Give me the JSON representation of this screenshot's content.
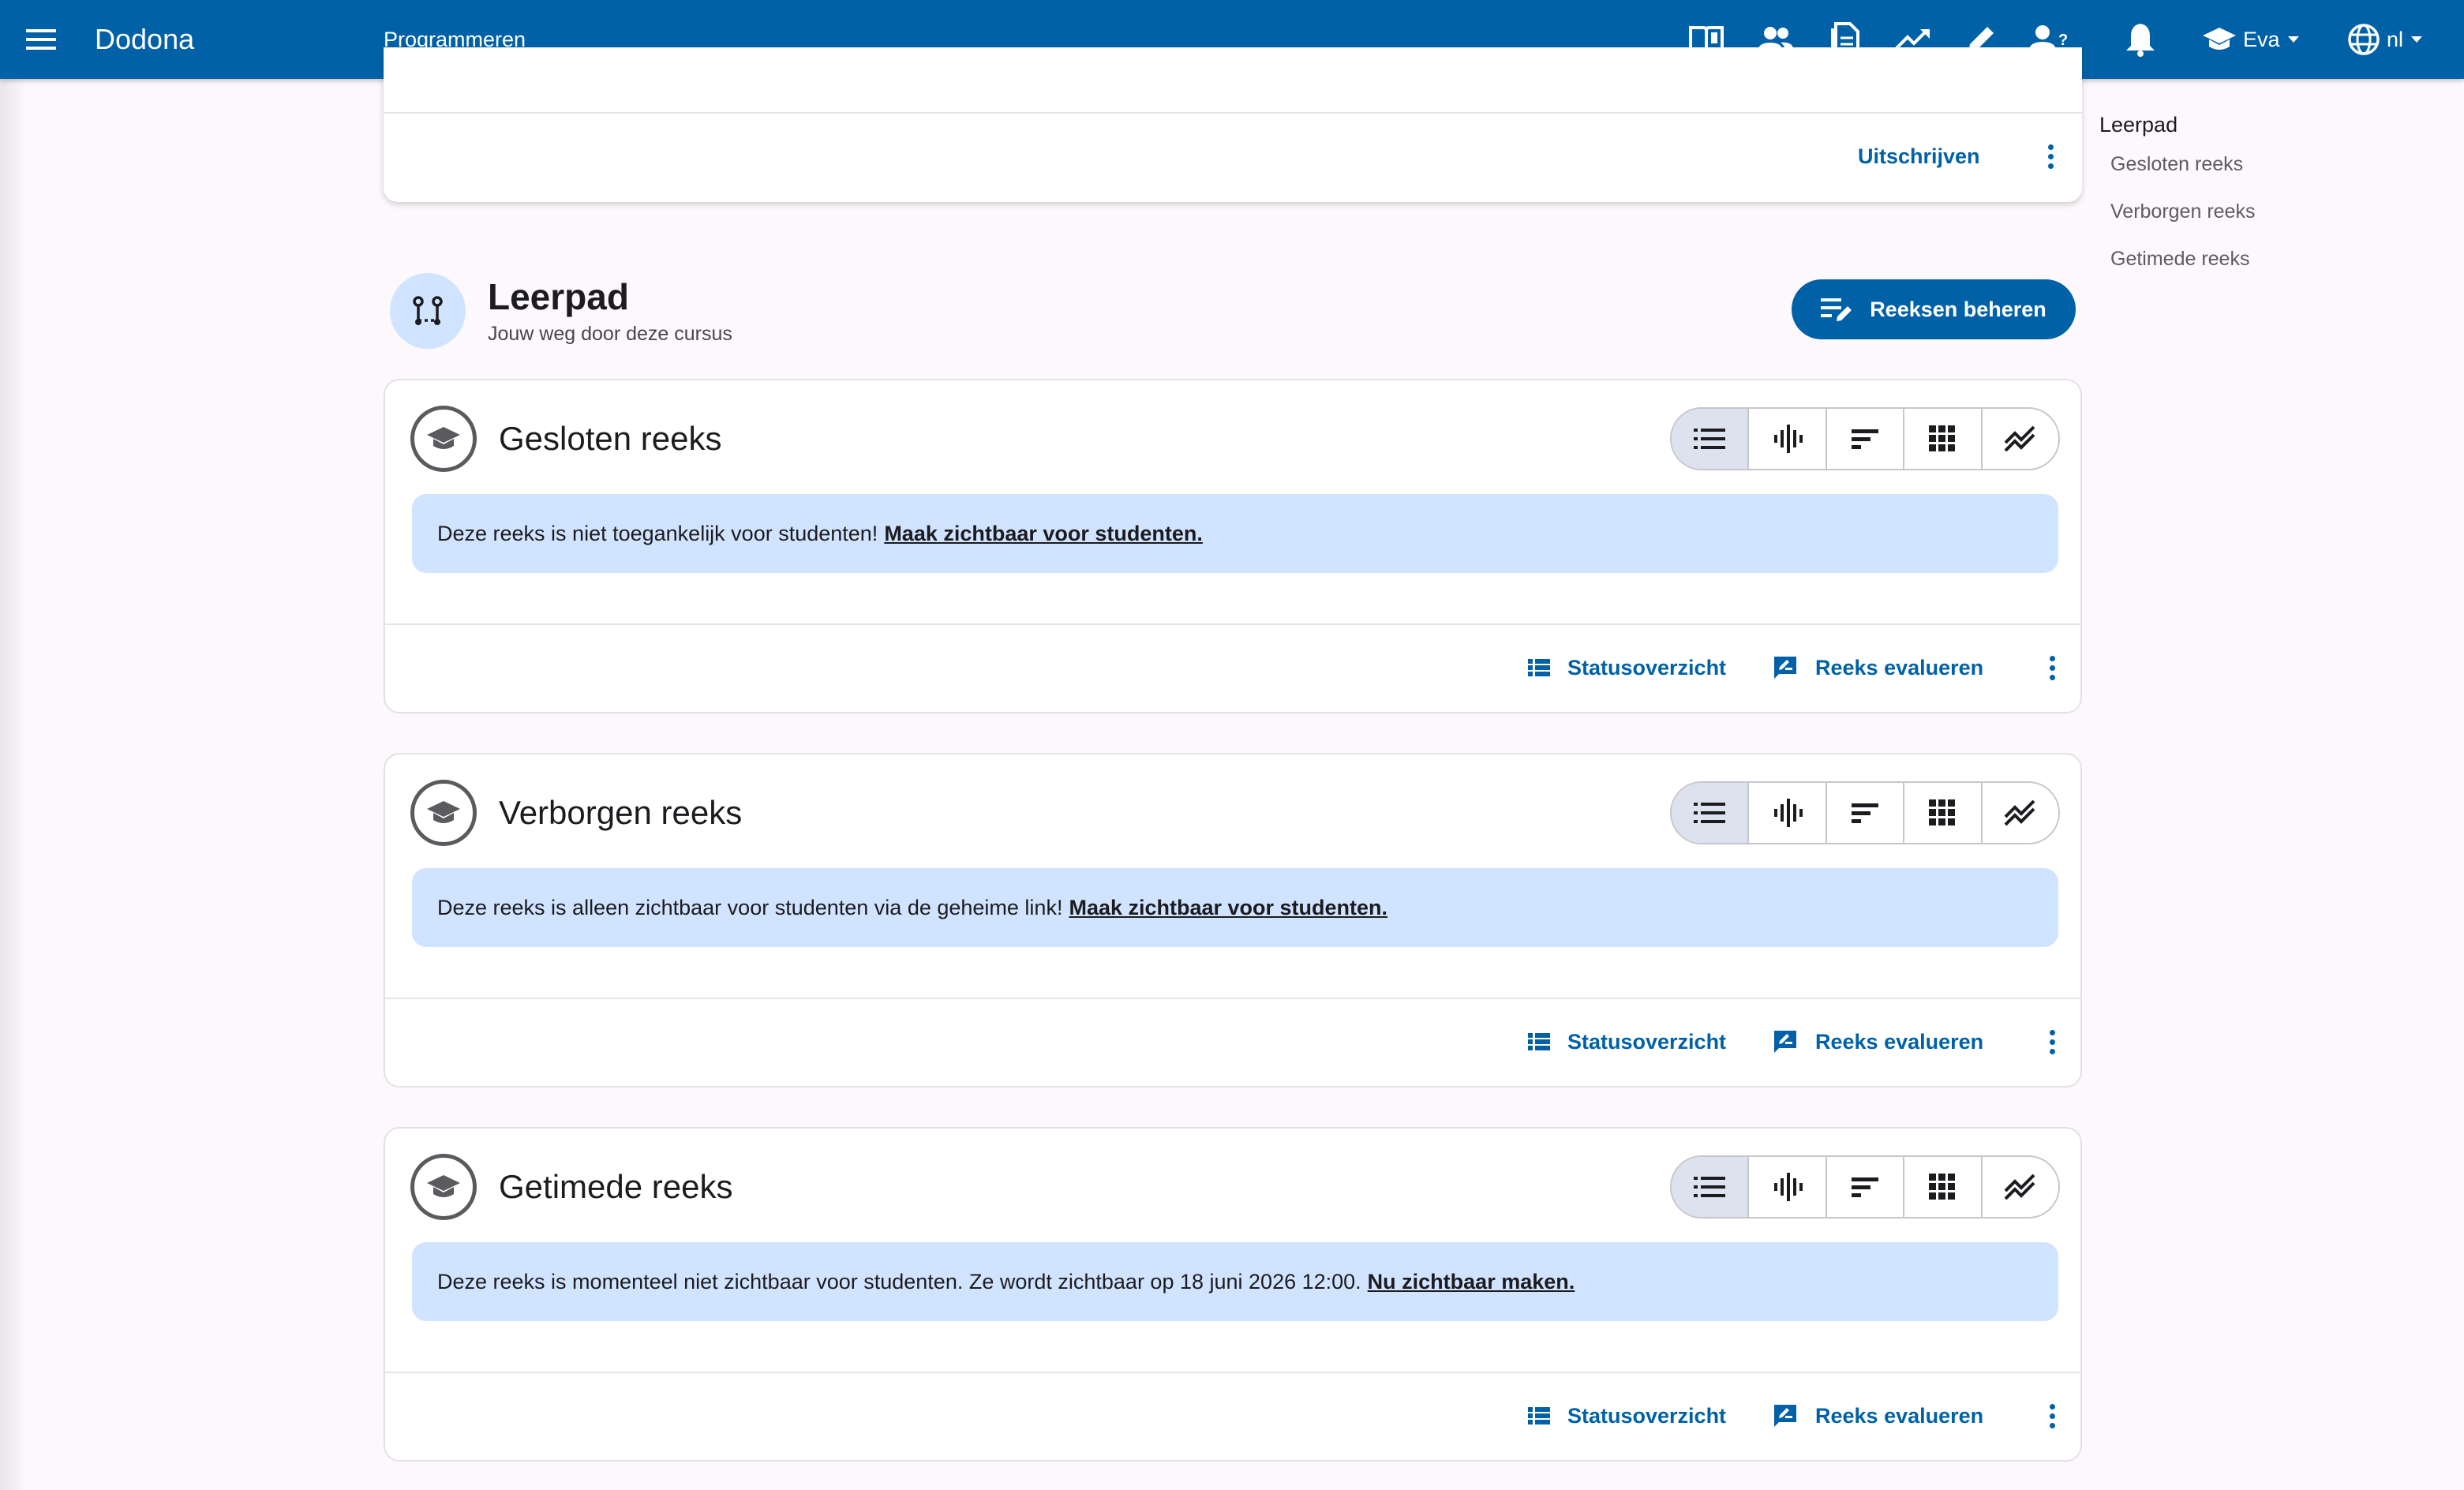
{
  "appbar": {
    "brand": "Dodona",
    "course": "Programmeren",
    "user_name": "Eva",
    "language": "nl",
    "nav_icons": [
      "course-book-icon",
      "users-icon",
      "document-icon",
      "trending-up-icon",
      "pencil-icon",
      "user-question-icon",
      "bell-icon"
    ]
  },
  "top_card": {
    "unsubscribe_label": "Uitschrijven"
  },
  "section": {
    "title": "Leerpad",
    "subtitle": "Jouw weg door deze cursus",
    "manage_button": "Reeksen beheren"
  },
  "toc": {
    "heading": "Leerpad",
    "items": [
      "Gesloten reeks",
      "Verborgen reeks",
      "Getimede reeks"
    ]
  },
  "series": [
    {
      "title": "Gesloten reeks",
      "message": "Deze reeks is niet toegankelijk voor studenten!",
      "action_link": "Maak zichtbaar voor studenten.",
      "status_label": "Statusoverzicht",
      "evaluate_label": "Reeks evalueren"
    },
    {
      "title": "Verborgen reeks",
      "message": "Deze reeks is alleen zichtbaar voor studenten via de geheime link!",
      "action_link": "Maak zichtbaar voor studenten.",
      "status_label": "Statusoverzicht",
      "evaluate_label": "Reeks evalueren"
    },
    {
      "title": "Getimede reeks",
      "message": "Deze reeks is momenteel niet zichtbaar voor studenten. Ze wordt zichtbaar op 18 juni 2026 12:00.",
      "action_link": "Nu zichtbaar maken.",
      "status_label": "Statusoverzicht",
      "evaluate_label": "Reeks evalueren"
    }
  ],
  "colors": {
    "primary": "#0061a7",
    "alert_bg": "#d1e4ff",
    "page_bg": "#fcf8fc"
  }
}
